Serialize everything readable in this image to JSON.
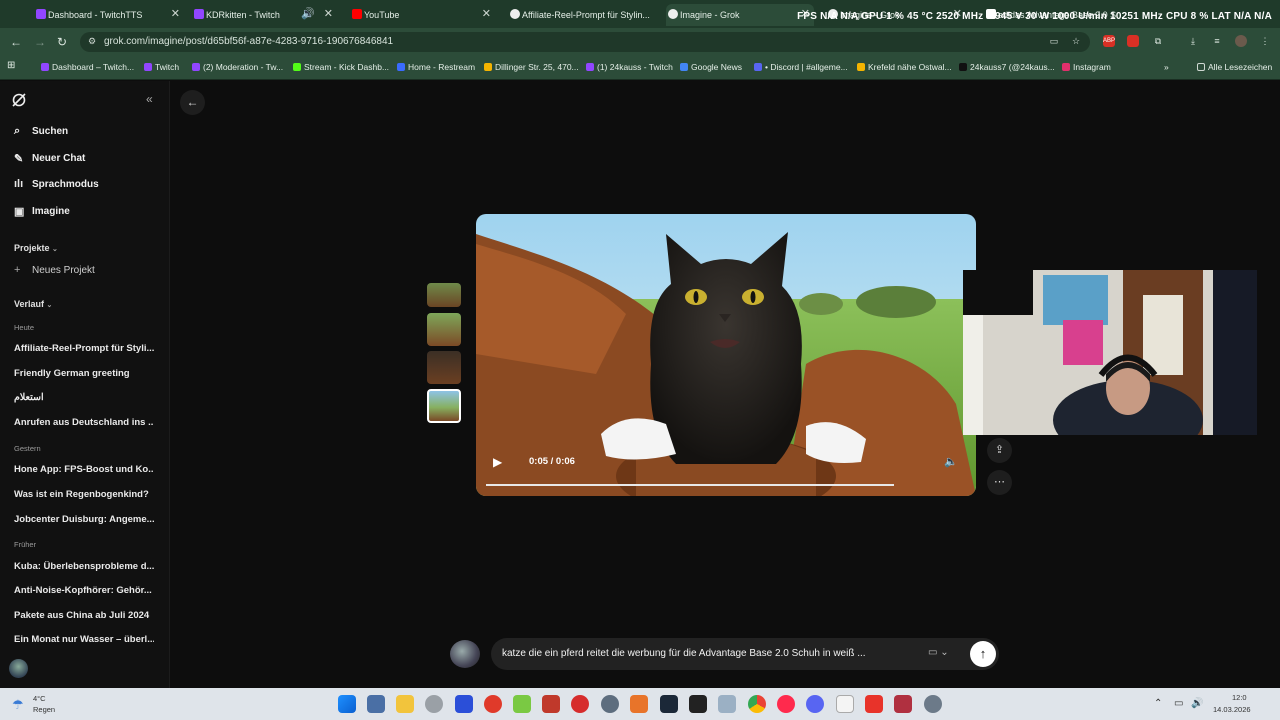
{
  "browser": {
    "tabs": [
      {
        "label": "Dashboard - TwitchTTS",
        "icon": "twitch-icon"
      },
      {
        "label": "KDRkitten - Twitch",
        "icon": "twitch-icon"
      },
      {
        "label": "YouTube",
        "icon": "youtube-icon"
      },
      {
        "label": "Affiliate-Reel-Prompt für Stylin...",
        "icon": "grok-icon"
      },
      {
        "label": "Imagine - Grok",
        "icon": "grok-icon"
      },
      {
        "label": "Imagine - Grok",
        "icon": "grok-icon"
      },
      {
        "label": "adidas Advantage Base 2.0 S...",
        "icon": "adidas-icon"
      }
    ],
    "hud": "FPS  N/A   N/A   GPU  1 %   45 °C  2520 MHz  0.945 V  30 W  1000 U/min  10251 MHz   CPU  8 %   LAT  N/A   N/A",
    "url": "grok.com/imagine/post/d65bf56f-a87e-4283-9716-190676846841",
    "bookmarks": [
      {
        "label": "Dashboard – Twitch...",
        "color": "#9146ff"
      },
      {
        "label": "Twitch",
        "color": "#9146ff"
      },
      {
        "label": "(2) Moderation - Tw...",
        "color": "#9146ff"
      },
      {
        "label": "Stream - Kick Dashb...",
        "color": "#53fc18"
      },
      {
        "label": "Home - Restream",
        "color": "#3a6bff"
      },
      {
        "label": "Dillinger Str. 25, 470...",
        "color": "#f4b400"
      },
      {
        "label": "(1) 24kauss - Twitch",
        "color": "#9146ff"
      },
      {
        "label": "Google News",
        "color": "#4285f4"
      },
      {
        "label": "• Discord | #allgeme...",
        "color": "#5865f2"
      },
      {
        "label": "Krefeld nähe Ostwal...",
        "color": "#f4b400"
      },
      {
        "label": "24kauss7 (@24kaus...",
        "color": "#111111"
      },
      {
        "label": "Instagram",
        "color": "#e1306c"
      }
    ],
    "all_bookmarks": "Alle Lesezeichen"
  },
  "sidebar": {
    "nav": [
      {
        "label": "Suchen",
        "icon": "search-icon"
      },
      {
        "label": "Neuer Chat",
        "icon": "edit-icon"
      },
      {
        "label": "Sprachmodus",
        "icon": "voice-icon"
      },
      {
        "label": "Imagine",
        "icon": "image-icon"
      }
    ],
    "projects_label": "Projekte",
    "new_project": "Neues Projekt",
    "history_label": "Verlauf",
    "groups": [
      {
        "label": "Heute",
        "items": [
          "Affiliate-Reel-Prompt für Styli...",
          "Friendly German greeting",
          "استعلام",
          "Anrufen aus Deutschland ins ..."
        ]
      },
      {
        "label": "Gestern",
        "items": [
          "Hone App: FPS-Boost und Ko...",
          "Was ist ein Regenbogenkind?",
          "Jobcenter Duisburg: Angeme..."
        ]
      },
      {
        "label": "Früher",
        "items": [
          "Kuba: Überlebensprobleme d...",
          "Anti-Noise-Kopfhörer: Gehör...",
          "Pakete aus China ab Juli 2024",
          "Ein Monat nur Wasser – überl..."
        ]
      }
    ]
  },
  "video": {
    "timecode": "0:05 / 0:06",
    "progress": 0.83
  },
  "prompt": {
    "text": "katze die ein pferd reitet die werbung für die Advantage Base 2.0 Schuh in weiß ..."
  },
  "taskbar": {
    "weather_temp": "4°C",
    "weather_cond": "Regen",
    "time": "12:0",
    "date": "14.03.2026"
  }
}
